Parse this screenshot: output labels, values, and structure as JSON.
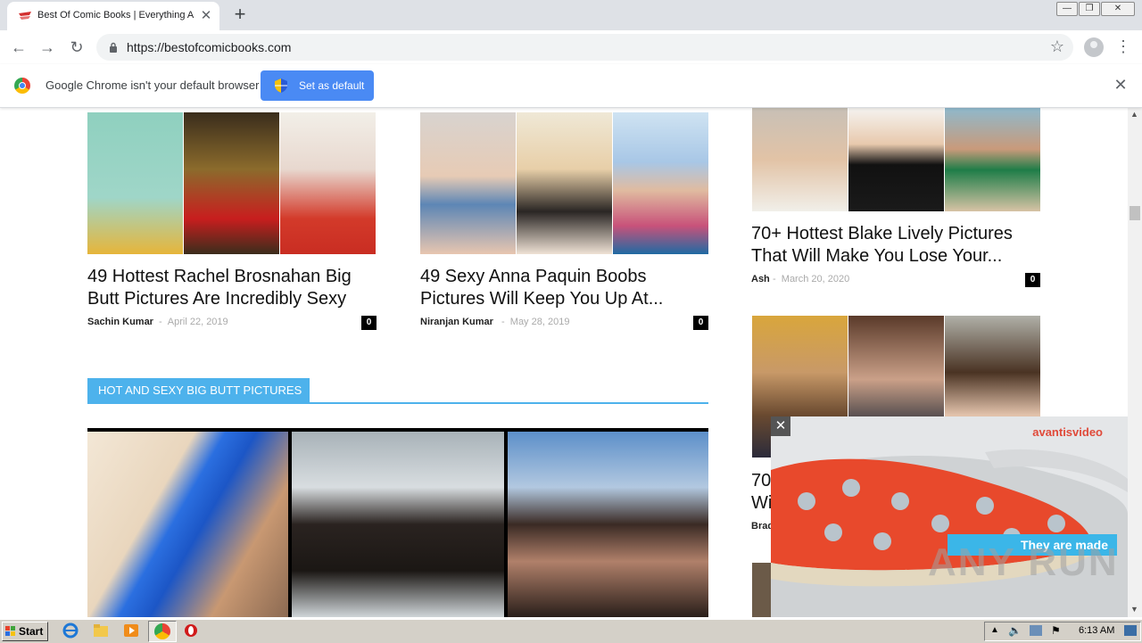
{
  "browser": {
    "tab_title": "Best Of Comic Books | Everything Ab",
    "url": "https://bestofcomicbooks.com",
    "infobar_text": "Google Chrome isn't your default browser",
    "set_default_label": "Set as default"
  },
  "posts_left": [
    {
      "title_line1": "49 Hottest Rachel Brosnahan Big",
      "title_line2": "Butt Pictures Are Incredibly Sexy",
      "author": "Sachin Kumar",
      "date": "April 22, 2019",
      "comments": "0"
    },
    {
      "title_line1": "49 Sexy Anna Paquin Boobs",
      "title_line2": "Pictures Will Keep You Up At...",
      "author": "Niranjan Kumar",
      "date": "May 28, 2019",
      "comments": "0"
    }
  ],
  "sidebar_posts": [
    {
      "title_line1": "70+ Hottest Blake Lively Pictures",
      "title_line2": "That Will Make You Lose Your...",
      "author": "Ash",
      "date": "March 20, 2020",
      "comments": "0"
    },
    {
      "title_line1": "70",
      "title_line2": "Wi",
      "author": "Brad"
    }
  ],
  "section": {
    "heading": "HOT AND SEXY BIG BUTT PICTURES"
  },
  "ad": {
    "brand": "avantisvideo",
    "caption": "They are made"
  },
  "watermark": "ANY RUN",
  "taskbar": {
    "start_label": "Start",
    "clock": "6:13 AM"
  },
  "colors": {
    "accent": "#4db2ec",
    "button_blue": "#4a8af4",
    "ad_red": "#e04a3a"
  }
}
